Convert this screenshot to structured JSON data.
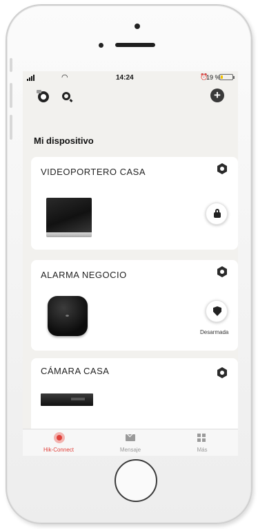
{
  "status_bar": {
    "time": "14:24",
    "battery_pct": "19 %",
    "battery_level": 0.19
  },
  "header": {
    "add_label": "+"
  },
  "section_title": "Mi dispositivo",
  "devices": [
    {
      "name": "VIDEOPORTERO CASA",
      "action_icon": "lock-icon"
    },
    {
      "name": "ALARMA NEGOCIO",
      "action_icon": "shield-icon",
      "status": "Desarmada"
    },
    {
      "name": "CÁMARA CASA"
    }
  ],
  "tabs": [
    {
      "label": "Hik-Connect",
      "active": true,
      "icon": "hik-connect-icon"
    },
    {
      "label": "Mensaje",
      "active": false,
      "icon": "mail-icon"
    },
    {
      "label": "Más",
      "active": false,
      "icon": "grid-icon"
    }
  ],
  "colors": {
    "accent": "#e0403a",
    "background": "#f2f1ee",
    "card": "#ffffff"
  }
}
